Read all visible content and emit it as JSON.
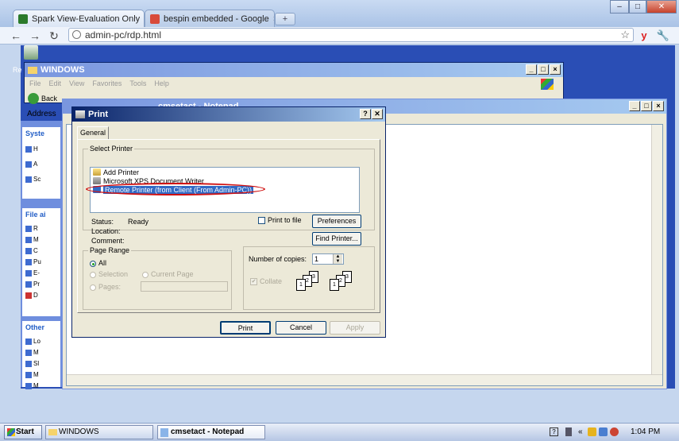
{
  "browser": {
    "tabs": [
      {
        "label": "Spark View-Evaluation Only",
        "close": "×"
      },
      {
        "label": "bespin embedded - Google",
        "close": "×"
      }
    ],
    "new_tab": "+",
    "window_buttons": [
      "–",
      "□",
      "✕"
    ],
    "url": "admin-pc/rdp.html",
    "back": "←",
    "forward": "→",
    "reload": "↻",
    "star": "☆",
    "ext": "y",
    "wrench": "🔧"
  },
  "remote": {
    "recycle_label": "Re",
    "explorer": {
      "title": "WINDOWS",
      "menu": [
        "File",
        "Edit",
        "View",
        "Favorites",
        "Tools",
        "Help"
      ],
      "back": "Back",
      "address": "Address"
    },
    "notepad": {
      "title": "cmsetact - Notepad"
    },
    "left_panel": {
      "system_title": "Syste",
      "file_title": "File ai",
      "other_title": "Other",
      "system_items": [
        "H",
        "A",
        "Sc"
      ],
      "file_items": [
        "R",
        "M",
        "C",
        "Pu",
        "E-",
        "Pr",
        "D"
      ],
      "other_items": [
        "Lo",
        "M",
        "Sl",
        "M",
        "M"
      ]
    }
  },
  "print_dialog": {
    "title": "Print",
    "help": "?",
    "close": "✕",
    "tab": "General",
    "select_printer_legend": "Select Printer",
    "printers": [
      {
        "name": "Add Printer",
        "selected": false
      },
      {
        "name": "Microsoft XPS Document Writer",
        "selected": false
      },
      {
        "name": "Remote Printer (from Client (From Admin-PC))",
        "selected": true
      }
    ],
    "status_label": "Status:",
    "status_value": "Ready",
    "location_label": "Location:",
    "comment_label": "Comment:",
    "print_to_file": "Print to file",
    "preferences": "Preferences",
    "find_printer": "Find Printer...",
    "page_range_legend": "Page Range",
    "range_all": "All",
    "range_selection": "Selection",
    "range_current": "Current Page",
    "range_pages": "Pages:",
    "copies_label": "Number of copies:",
    "copies_value": "1",
    "collate": "Collate",
    "print_btn": "Print",
    "cancel_btn": "Cancel",
    "apply_btn": "Apply",
    "highlight_color": "#d01010"
  },
  "taskbar": {
    "start": "Start",
    "tasks": [
      {
        "label": "WINDOWS",
        "active": false
      },
      {
        "label": "cmsetact - Notepad",
        "active": true
      }
    ],
    "time": "1:04 PM",
    "tray_chevron": "«"
  }
}
